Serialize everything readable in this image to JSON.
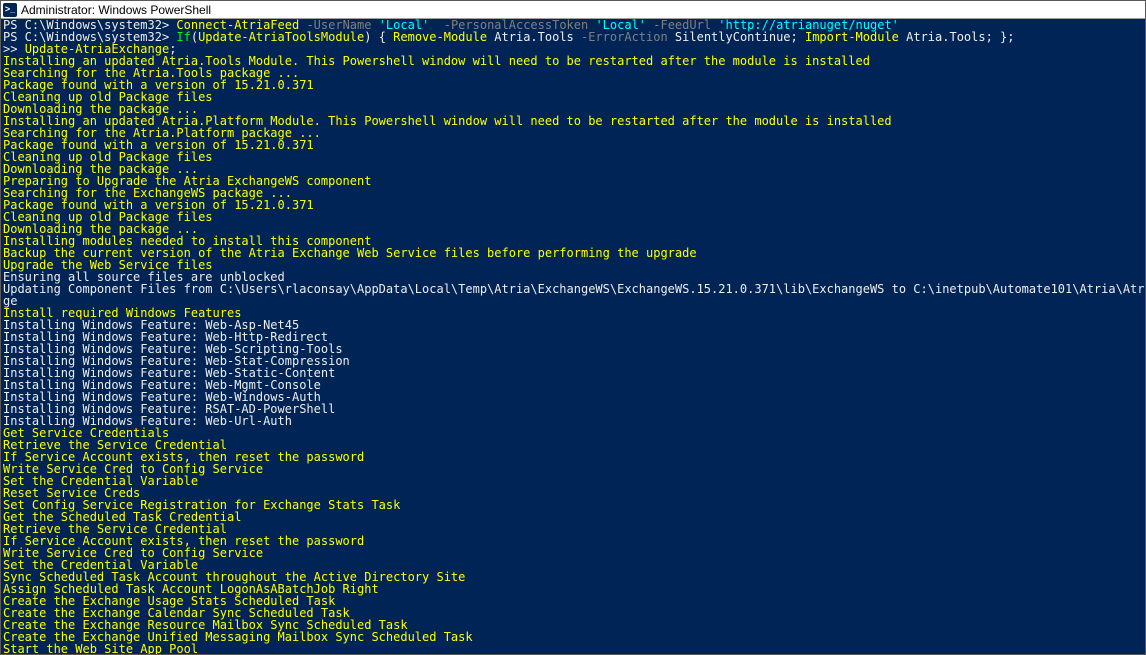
{
  "titlebar": {
    "icon_label": ">_",
    "title": "Administrator: Windows PowerShell"
  },
  "lines": [
    {
      "segments": [
        {
          "cls": "c-white",
          "text": "PS C:\\Windows\\system32> "
        },
        {
          "cls": "c-yellow",
          "text": "Connect-AtriaFeed"
        },
        {
          "cls": "c-gray",
          "text": " -UserName "
        },
        {
          "cls": "c-teal",
          "text": "'Local'"
        },
        {
          "cls": "c-gray",
          "text": "  -PersonalAccessToken "
        },
        {
          "cls": "c-teal",
          "text": "'Local'"
        },
        {
          "cls": "c-gray",
          "text": " -FeedUrl "
        },
        {
          "cls": "c-teal",
          "text": "'http://atrianuget/nuget'"
        }
      ]
    },
    {
      "segments": [
        {
          "cls": "c-white",
          "text": "PS C:\\Windows\\system32> "
        },
        {
          "cls": "c-green",
          "text": "If"
        },
        {
          "cls": "c-white",
          "text": "("
        },
        {
          "cls": "c-yellow",
          "text": "Update-AtriaToolsModule"
        },
        {
          "cls": "c-white",
          "text": ") { "
        },
        {
          "cls": "c-yellow",
          "text": "Remove-Module"
        },
        {
          "cls": "c-white",
          "text": " Atria.Tools "
        },
        {
          "cls": "c-gray",
          "text": "-ErrorAction"
        },
        {
          "cls": "c-white",
          "text": " SilentlyContinue; "
        },
        {
          "cls": "c-yellow",
          "text": "Import-Module"
        },
        {
          "cls": "c-white",
          "text": " Atria.Tools; };"
        }
      ]
    },
    {
      "segments": [
        {
          "cls": "c-white",
          "text": ">> "
        },
        {
          "cls": "c-yellow",
          "text": "Update-AtriaExchange"
        },
        {
          "cls": "c-white",
          "text": ";"
        }
      ]
    },
    {
      "segments": [
        {
          "cls": "c-yellow",
          "text": "Installing an updated Atria.Tools Module. This Powershell window will need to be restarted after the module is installed"
        }
      ]
    },
    {
      "segments": [
        {
          "cls": "c-yellow",
          "text": "Searching for the Atria.Tools package ..."
        }
      ]
    },
    {
      "segments": [
        {
          "cls": "c-yellow",
          "text": "Package found with a version of 15.21.0.371"
        }
      ]
    },
    {
      "segments": [
        {
          "cls": "c-yellow",
          "text": "Cleaning up old Package files"
        }
      ]
    },
    {
      "segments": [
        {
          "cls": "c-yellow",
          "text": "Downloading the package ..."
        }
      ]
    },
    {
      "segments": [
        {
          "cls": "c-yellow",
          "text": "Installing an updated Atria.Platform Module. This Powershell window will need to be restarted after the module is installed"
        }
      ]
    },
    {
      "segments": [
        {
          "cls": "c-yellow",
          "text": "Searching for the Atria.Platform package ..."
        }
      ]
    },
    {
      "segments": [
        {
          "cls": "c-yellow",
          "text": "Package found with a version of 15.21.0.371"
        }
      ]
    },
    {
      "segments": [
        {
          "cls": "c-yellow",
          "text": "Cleaning up old Package files"
        }
      ]
    },
    {
      "segments": [
        {
          "cls": "c-yellow",
          "text": "Downloading the package ..."
        }
      ]
    },
    {
      "segments": [
        {
          "cls": "c-yellow",
          "text": "Preparing to Upgrade the Atria ExchangeWS component"
        }
      ]
    },
    {
      "segments": [
        {
          "cls": "c-yellow",
          "text": "Searching for the ExchangeWS package ..."
        }
      ]
    },
    {
      "segments": [
        {
          "cls": "c-yellow",
          "text": "Package found with a version of 15.21.0.371"
        }
      ]
    },
    {
      "segments": [
        {
          "cls": "c-yellow",
          "text": "Cleaning up old Package files"
        }
      ]
    },
    {
      "segments": [
        {
          "cls": "c-yellow",
          "text": "Downloading the package ..."
        }
      ]
    },
    {
      "segments": [
        {
          "cls": "c-yellow",
          "text": "Installing modules needed to install this component"
        }
      ]
    },
    {
      "segments": [
        {
          "cls": "c-yellow",
          "text": "Backup the current version of the Atria Exchange Web Service files before performing the upgrade"
        }
      ]
    },
    {
      "segments": [
        {
          "cls": "c-yellow",
          "text": "Upgrade the Web Service files"
        }
      ]
    },
    {
      "segments": [
        {
          "cls": "c-white",
          "text": "Ensuring all source files are unblocked"
        }
      ]
    },
    {
      "segments": [
        {
          "cls": "c-white",
          "text": "Updating Component Files from C:\\Users\\rlaconsay\\AppData\\Local\\Temp\\Atria\\ExchangeWS\\ExchangeWS.15.21.0.371\\lib\\ExchangeWS to C:\\inetpub\\Automate101\\Atria\\Atria Web"
        }
      ]
    },
    {
      "segments": [
        {
          "cls": "c-white",
          "text": "ge"
        }
      ]
    },
    {
      "segments": [
        {
          "cls": "c-yellow",
          "text": "Install required Windows Features"
        }
      ]
    },
    {
      "segments": [
        {
          "cls": "c-white",
          "text": "Installing Windows Feature: Web-Asp-Net45"
        }
      ]
    },
    {
      "segments": [
        {
          "cls": "c-white",
          "text": "Installing Windows Feature: Web-Http-Redirect"
        }
      ]
    },
    {
      "segments": [
        {
          "cls": "c-white",
          "text": "Installing Windows Feature: Web-Scripting-Tools"
        }
      ]
    },
    {
      "segments": [
        {
          "cls": "c-white",
          "text": "Installing Windows Feature: Web-Stat-Compression"
        }
      ]
    },
    {
      "segments": [
        {
          "cls": "c-white",
          "text": "Installing Windows Feature: Web-Static-Content"
        }
      ]
    },
    {
      "segments": [
        {
          "cls": "c-white",
          "text": "Installing Windows Feature: Web-Mgmt-Console"
        }
      ]
    },
    {
      "segments": [
        {
          "cls": "c-white",
          "text": "Installing Windows Feature: Web-Windows-Auth"
        }
      ]
    },
    {
      "segments": [
        {
          "cls": "c-white",
          "text": "Installing Windows Feature: RSAT-AD-PowerShell"
        }
      ]
    },
    {
      "segments": [
        {
          "cls": "c-white",
          "text": "Installing Windows Feature: Web-Url-Auth"
        }
      ]
    },
    {
      "segments": [
        {
          "cls": "c-yellow",
          "text": "Get Service Credentials"
        }
      ]
    },
    {
      "segments": [
        {
          "cls": "c-yellow",
          "text": "Retrieve the Service Credential"
        }
      ]
    },
    {
      "segments": [
        {
          "cls": "c-yellow",
          "text": "If Service Account exists, then reset the password"
        }
      ]
    },
    {
      "segments": [
        {
          "cls": "c-yellow",
          "text": "Write Service Cred to Config Service"
        }
      ]
    },
    {
      "segments": [
        {
          "cls": "c-yellow",
          "text": "Set the Credential Variable"
        }
      ]
    },
    {
      "segments": [
        {
          "cls": "c-yellow",
          "text": "Reset Service Creds"
        }
      ]
    },
    {
      "segments": [
        {
          "cls": "c-yellow",
          "text": "Set Config Service Registration for Exchange Stats Task"
        }
      ]
    },
    {
      "segments": [
        {
          "cls": "c-yellow",
          "text": "Get the Scheduled Task Credential"
        }
      ]
    },
    {
      "segments": [
        {
          "cls": "c-yellow",
          "text": "Retrieve the Service Credential"
        }
      ]
    },
    {
      "segments": [
        {
          "cls": "c-yellow",
          "text": "If Service Account exists, then reset the password"
        }
      ]
    },
    {
      "segments": [
        {
          "cls": "c-yellow",
          "text": "Write Service Cred to Config Service"
        }
      ]
    },
    {
      "segments": [
        {
          "cls": "c-yellow",
          "text": "Set the Credential Variable"
        }
      ]
    },
    {
      "segments": [
        {
          "cls": "c-yellow",
          "text": "Sync Scheduled Task Account throughout the Active Directory Site"
        }
      ]
    },
    {
      "segments": [
        {
          "cls": "c-yellow",
          "text": "Assign Scheduled Task Account LogonAsABatchJob Right"
        }
      ]
    },
    {
      "segments": [
        {
          "cls": "c-yellow",
          "text": "Create the Exchange Usage Stats Scheduled Task"
        }
      ]
    },
    {
      "segments": [
        {
          "cls": "c-yellow",
          "text": "Create the Exchange Calendar Sync Scheduled Task"
        }
      ]
    },
    {
      "segments": [
        {
          "cls": "c-yellow",
          "text": "Create the Exchange Resource Mailbox Sync Scheduled Task"
        }
      ]
    },
    {
      "segments": [
        {
          "cls": "c-yellow",
          "text": "Create the Exchange Unified Messaging Mailbox Sync Scheduled Task"
        }
      ]
    },
    {
      "segments": [
        {
          "cls": "c-yellow",
          "text": "Start the Web Site App Pool"
        }
      ]
    }
  ]
}
